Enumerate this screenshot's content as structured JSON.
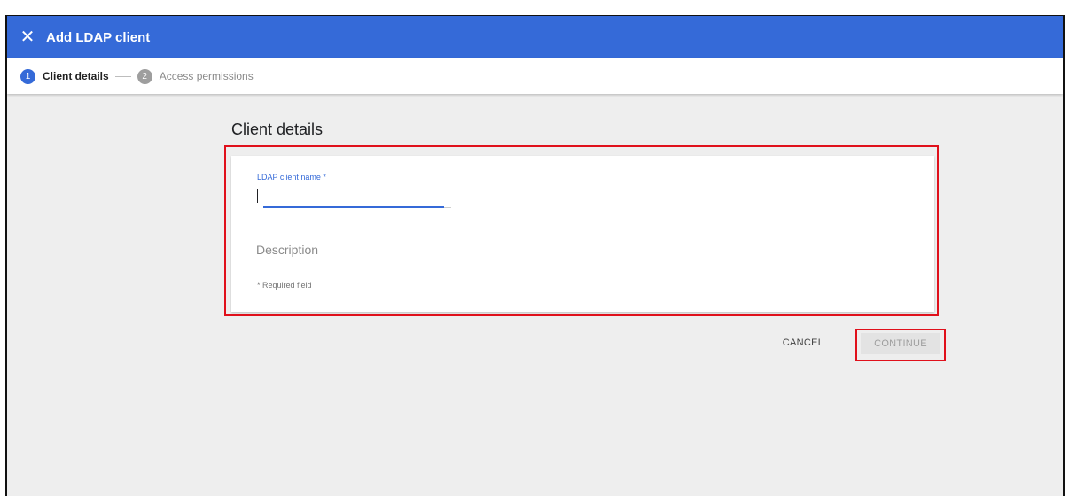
{
  "header": {
    "close_icon": "close-icon",
    "close_glyph": "✕",
    "title": "Add LDAP client",
    "color": "#356ad8"
  },
  "stepper": {
    "steps": [
      {
        "number": "1",
        "label": "Client details",
        "state": "active"
      },
      {
        "number": "2",
        "label": "Access permissions",
        "state": "inactive"
      }
    ]
  },
  "main": {
    "section_title": "Client details",
    "form": {
      "name_label": "LDAP client name *",
      "name_value": "",
      "description_value": "",
      "description_placeholder": "Description",
      "required_note": "* Required field"
    },
    "actions": {
      "cancel_label": "CANCEL",
      "continue_label": "CONTINUE",
      "continue_state": "disabled"
    }
  },
  "colors": {
    "accent": "#356ad8",
    "annotation_highlight": "#e0101b",
    "background": "#eeeeee"
  }
}
